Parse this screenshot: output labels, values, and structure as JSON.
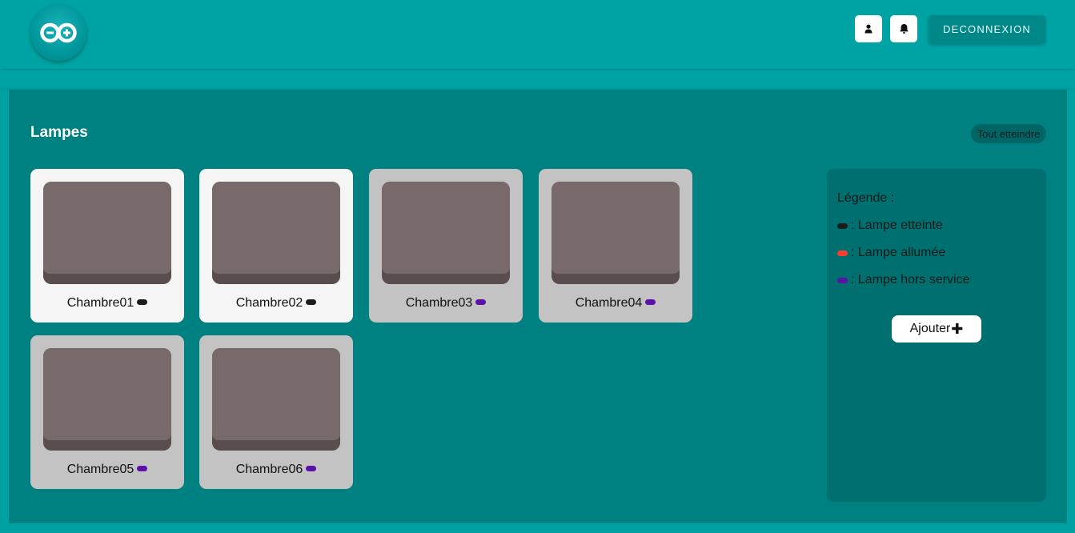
{
  "header": {
    "logo_icon": "arduino-logo",
    "profile_icon": "user-icon",
    "notification_icon": "bell-icon",
    "logout_label": "DECONNEXION"
  },
  "main": {
    "title": "Lampes",
    "all_off_label": "Tout etteindre",
    "lamps": [
      {
        "name": "Chambre01",
        "status": "off"
      },
      {
        "name": "Chambre02",
        "status": "off"
      },
      {
        "name": "Chambre03",
        "status": "out_of_service"
      },
      {
        "name": "Chambre04",
        "status": "out_of_service"
      },
      {
        "name": "Chambre05",
        "status": "out_of_service"
      },
      {
        "name": "Chambre06",
        "status": "out_of_service"
      }
    ]
  },
  "legend": {
    "title": "Légende :",
    "items": [
      {
        "label": ": Lampe etteinte",
        "color": "#1c1c1c"
      },
      {
        "label": ": Lampe allumée",
        "color": "#ff3d2e"
      },
      {
        "label": ": Lampe hors service",
        "color": "#5b10a8"
      }
    ],
    "add_label": "Ajouter",
    "add_icon": "plus-icon"
  },
  "colors": {
    "header_bg": "#00a3a3",
    "panel_bg": "#008181",
    "legend_bg": "#006f6f",
    "card_off_bg": "#f5f5f5",
    "card_oos_bg": "#c3c3c3",
    "lamp_off": "#1c1c1c",
    "lamp_on": "#ff3d2e",
    "lamp_oos": "#5b10a8"
  }
}
